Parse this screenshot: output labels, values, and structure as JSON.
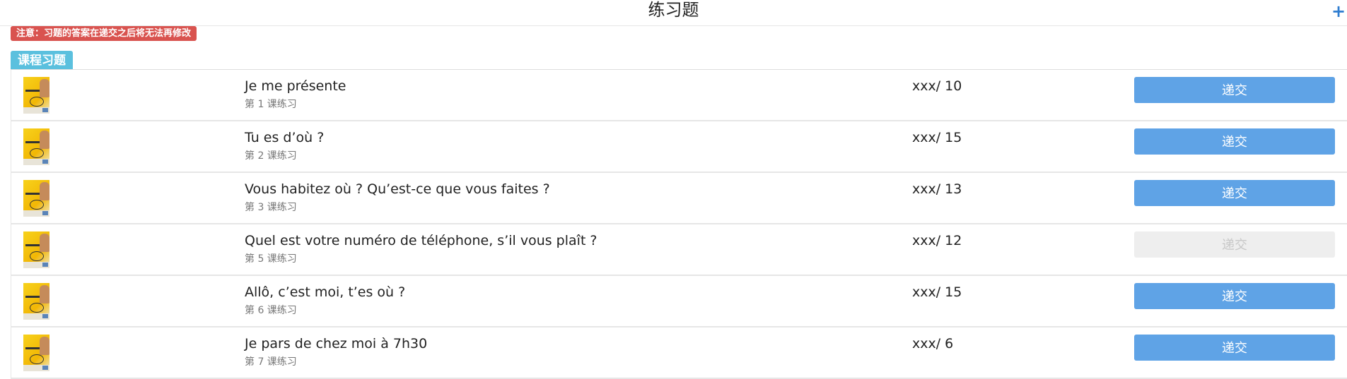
{
  "header": {
    "title": "练习题",
    "add_icon": "plus-icon"
  },
  "notice": "注意：习题的答案在递交之后将无法再修改",
  "section": {
    "label": "课程习题"
  },
  "colors": {
    "accent": "#5fa3e6",
    "notice": "#d9534f",
    "section": "#5bc0de",
    "disabled": "#eeeeee"
  },
  "exercises": [
    {
      "title": "Je me présente",
      "subtitle": "第 1 课练习",
      "score": "xxx/ 10",
      "button": "递交",
      "enabled": true
    },
    {
      "title": "Tu es d’où ?",
      "subtitle": "第 2 课练习",
      "score": "xxx/ 15",
      "button": "递交",
      "enabled": true
    },
    {
      "title": "Vous habitez où ? Qu’est-ce que vous faites ?",
      "subtitle": "第 3 课练习",
      "score": "xxx/ 13",
      "button": "递交",
      "enabled": true
    },
    {
      "title": "Quel est votre numéro de téléphone, s’il vous plaît ?",
      "subtitle": "第 5 课练习",
      "score": "xxx/ 12",
      "button": "递交",
      "enabled": false
    },
    {
      "title": "Allô, c’est moi, t’es où ?",
      "subtitle": "第 6 课练习",
      "score": "xxx/ 15",
      "button": "递交",
      "enabled": true
    },
    {
      "title": "Je pars de chez moi à 7h30",
      "subtitle": "第 7 课练习",
      "score": "xxx/ 6",
      "button": "递交",
      "enabled": true
    }
  ]
}
